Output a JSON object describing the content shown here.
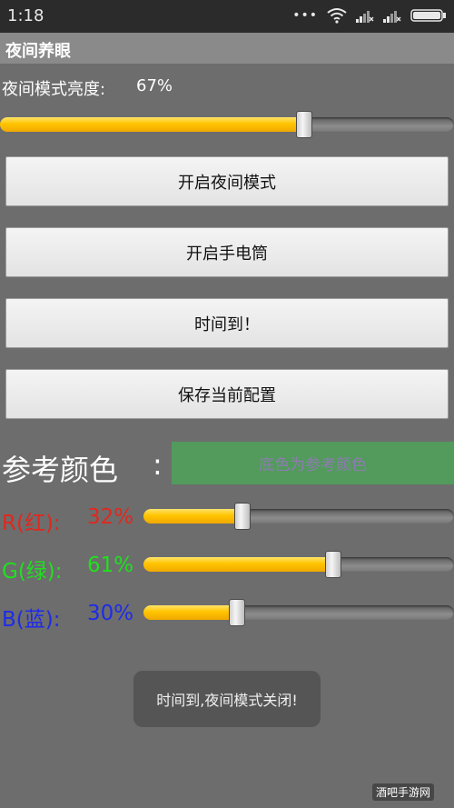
{
  "status_bar": {
    "time": "1:18",
    "icons": [
      "dots-icon",
      "wifi-icon",
      "signal-1-icon",
      "signal-2-icon",
      "battery-icon"
    ]
  },
  "app": {
    "title": "夜间养眼"
  },
  "brightness": {
    "label": "夜间模式亮度:",
    "value_text": "67%",
    "value": 0.67
  },
  "buttons": [
    {
      "label": "开启夜间模式"
    },
    {
      "label": "开启手电筒"
    },
    {
      "label": "时间到！"
    },
    {
      "label": "保存当前配置"
    }
  ],
  "reference_color": {
    "label": "参考颜色",
    "colon": ":",
    "swatch_text": "底色为参考颜色",
    "swatch_color": "#529b5c",
    "swatch_text_color": "#8e7bb0"
  },
  "rgb": [
    {
      "label": "R(红):",
      "value_text": "32%",
      "value": 0.32,
      "color": "#e0281e"
    },
    {
      "label": "G(绿):",
      "value_text": "61%",
      "value": 0.61,
      "color": "#1fe01f"
    },
    {
      "label": "B(蓝):",
      "value_text": "30%",
      "value": 0.3,
      "color": "#1e2be8"
    }
  ],
  "toast": {
    "text": "时间到,夜间模式关闭!"
  },
  "watermark": {
    "text": "酒吧手游网"
  }
}
